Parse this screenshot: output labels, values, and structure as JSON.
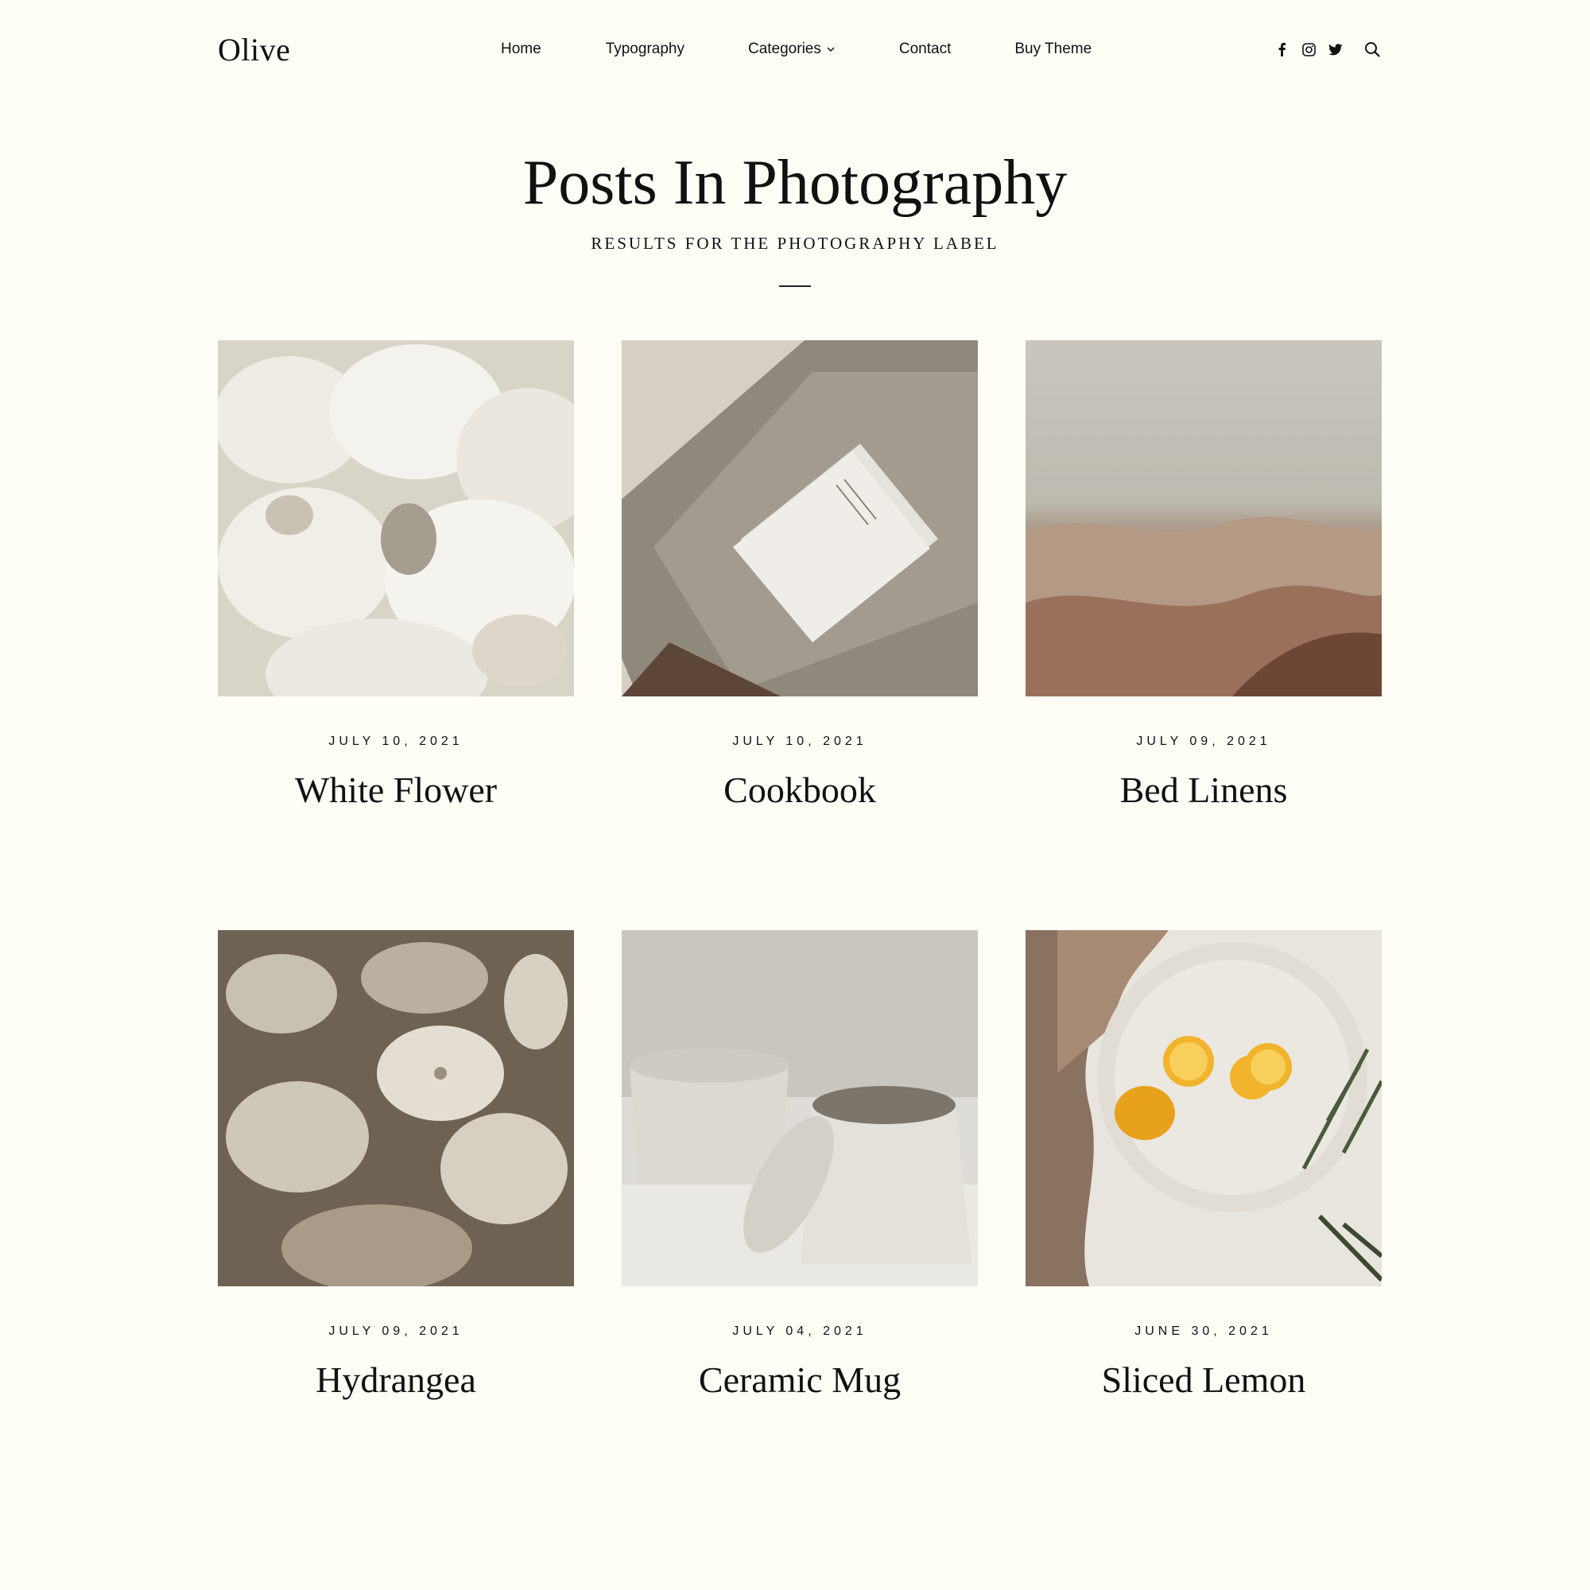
{
  "header": {
    "logo": "Olive",
    "nav": {
      "home": "Home",
      "typography": "Typography",
      "categories": "Categories",
      "contact": "Contact",
      "buy_theme": "Buy Theme"
    },
    "icons": [
      "facebook-icon",
      "instagram-icon",
      "twitter-icon",
      "search-icon"
    ]
  },
  "page": {
    "title": "Posts In Photography",
    "subtitle": "RESULTS FOR THE PHOTOGRAPHY LABEL"
  },
  "posts": [
    {
      "date": "JULY 10, 2021",
      "title": "White Flower"
    },
    {
      "date": "JULY 10, 2021",
      "title": "Cookbook"
    },
    {
      "date": "JULY 09, 2021",
      "title": "Bed Linens"
    },
    {
      "date": "JULY 09, 2021",
      "title": "Hydrangea"
    },
    {
      "date": "JULY 04, 2021",
      "title": "Ceramic Mug"
    },
    {
      "date": "JUNE 30, 2021",
      "title": "Sliced Lemon"
    }
  ],
  "colors": {
    "background": "#fefdf6",
    "text": "#111111"
  }
}
